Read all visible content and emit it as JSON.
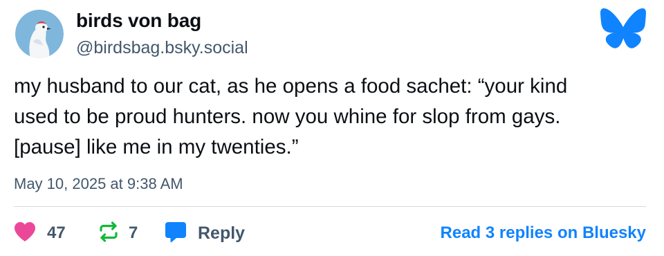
{
  "author": {
    "display_name": "birds von bag",
    "handle": "@birdsbag.bsky.social"
  },
  "post": {
    "text": "my husband to our cat, as he opens a food sachet: “your kind\nused to be proud hunters. now you whine for slop from gays.\n[pause] like me in my twenties.”",
    "timestamp": "May 10, 2025 at 9:38 AM"
  },
  "actions": {
    "likes": "47",
    "reposts": "7",
    "reply_label": "Reply",
    "read_replies_label": "Read 3 replies on Bluesky"
  },
  "colors": {
    "bluesky_blue": "#1083fe",
    "like_pink": "#ec4899",
    "repost_green": "#13b83a",
    "muted_text": "#42576c"
  },
  "icons": {
    "logo": "bluesky-butterfly-icon",
    "like": "heart-icon",
    "repost": "repost-icon",
    "reply": "speech-bubble-icon"
  }
}
